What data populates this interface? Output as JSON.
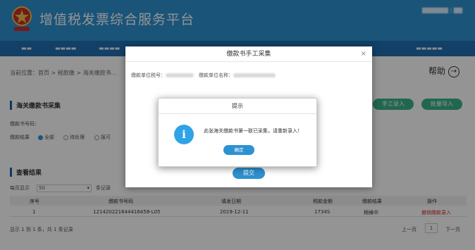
{
  "app": {
    "title": "增值税发票综合服务平台"
  },
  "breadcrumb": {
    "text": "当前位置：首页 > 税款缴 > 海关缴款书..."
  },
  "help": {
    "label": "帮助"
  },
  "section_customs": {
    "title": "海关缴款书采集"
  },
  "buttons": {
    "manual_entry": "手工录入",
    "import": "批量导入"
  },
  "filters": {
    "id_label": "缴款书号码：",
    "result_label": "缴款结果",
    "radio_all": "全部",
    "radio_pending": "待处理",
    "radio_other": "报可"
  },
  "section_results": {
    "title": "查看结果"
  },
  "pager_top": {
    "per_page_label": "每页显示",
    "per_page_value": "50",
    "suffix": "条记录"
  },
  "table": {
    "headers": [
      "序号",
      "缴款书号码",
      "填发日期",
      "税款金额",
      "缴款结果",
      "操作"
    ],
    "rows": [
      {
        "index": "1",
        "number": "121420221644416458-L05",
        "date": "2019-12-11",
        "amount": "1734S",
        "status": "稍候中",
        "action": "撤销缴款录入"
      }
    ]
  },
  "footer": {
    "summary": "显示 1 到 1 条，共 1 条记录",
    "prev": "上一页",
    "page": "1",
    "next": "下一页"
  },
  "modal": {
    "title": "缴款书手工采集",
    "close": "×",
    "taxpayer_id_label": "缴款单位税号：",
    "taxpayer_name_label": "缴款单位名称：",
    "submit": "提交"
  },
  "dialog": {
    "title": "提示",
    "icon": "i",
    "message": "此张海关缴款书第一联已采集，请重新录入！",
    "confirm": "确定"
  },
  "colors": {
    "header": "#2d92d0",
    "nav": "#1f6fb0",
    "accent": "#2d92d0",
    "success": "#3ab18a"
  }
}
